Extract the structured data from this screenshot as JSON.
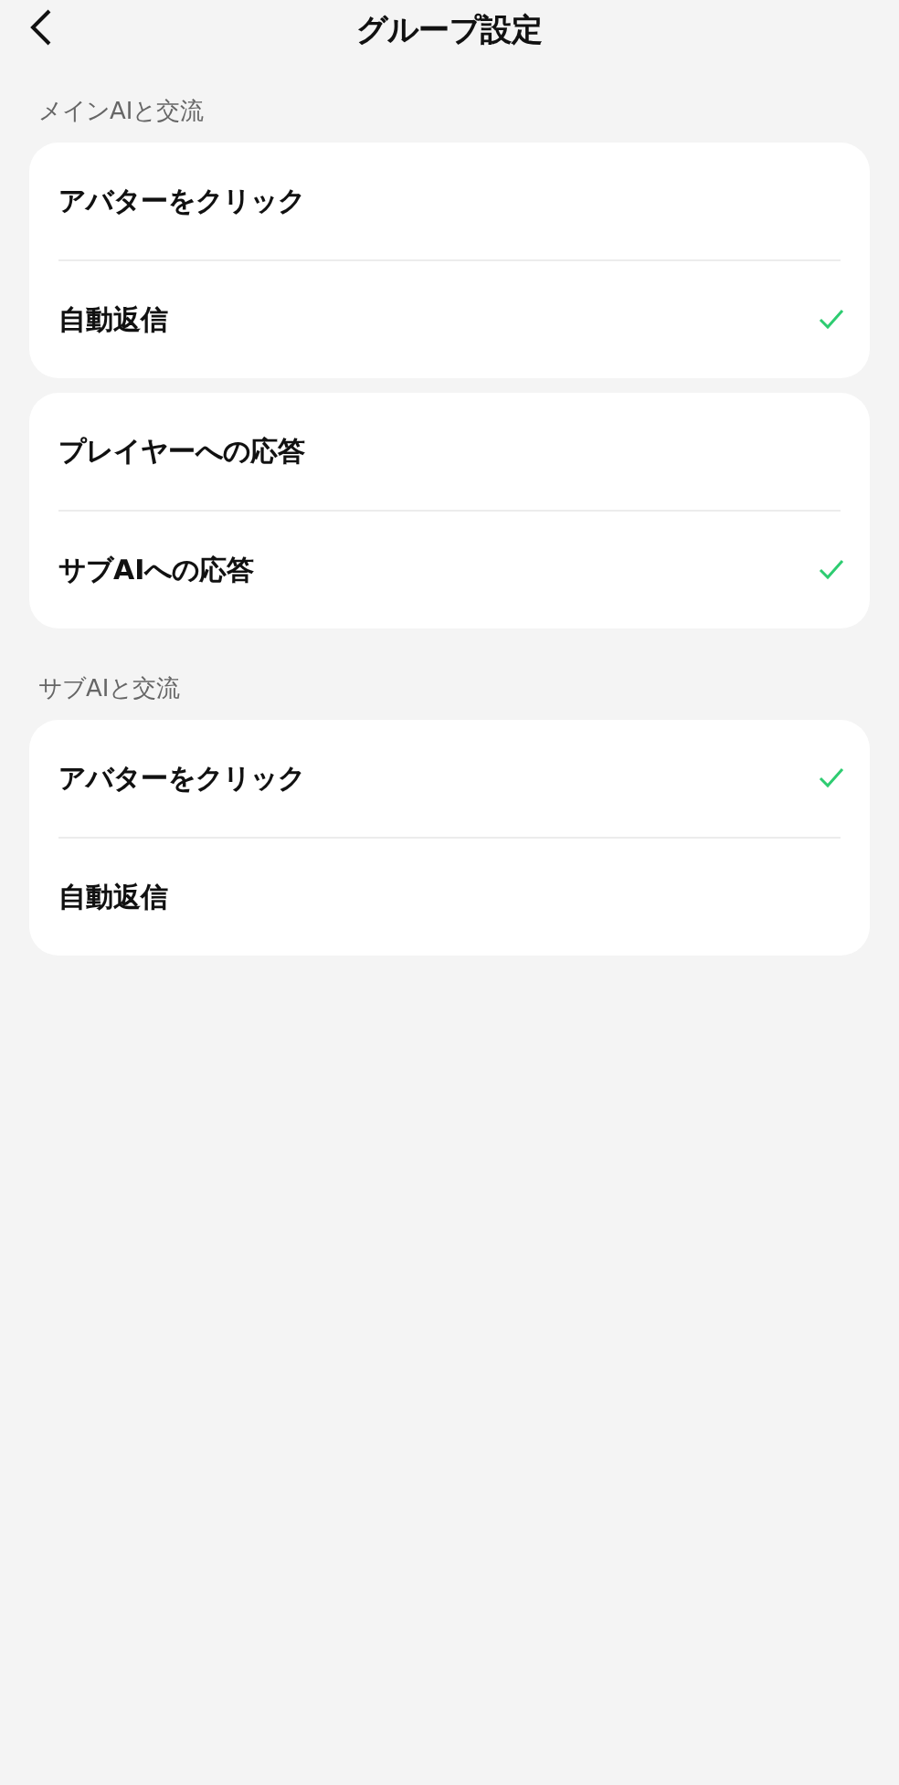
{
  "header": {
    "title": "グループ設定"
  },
  "sections": [
    {
      "heading": "メインAIと交流",
      "cards": [
        {
          "items": [
            {
              "label": "アバターをクリック",
              "checked": false
            },
            {
              "label": "自動返信",
              "checked": true
            }
          ]
        },
        {
          "items": [
            {
              "label": "プレイヤーへの応答",
              "checked": false
            },
            {
              "label": "サブAIへの応答",
              "checked": true
            }
          ]
        }
      ]
    },
    {
      "heading": "サブAIと交流",
      "cards": [
        {
          "items": [
            {
              "label": "アバターをクリック",
              "checked": true
            },
            {
              "label": "自動返信",
              "checked": false
            }
          ]
        }
      ]
    }
  ]
}
